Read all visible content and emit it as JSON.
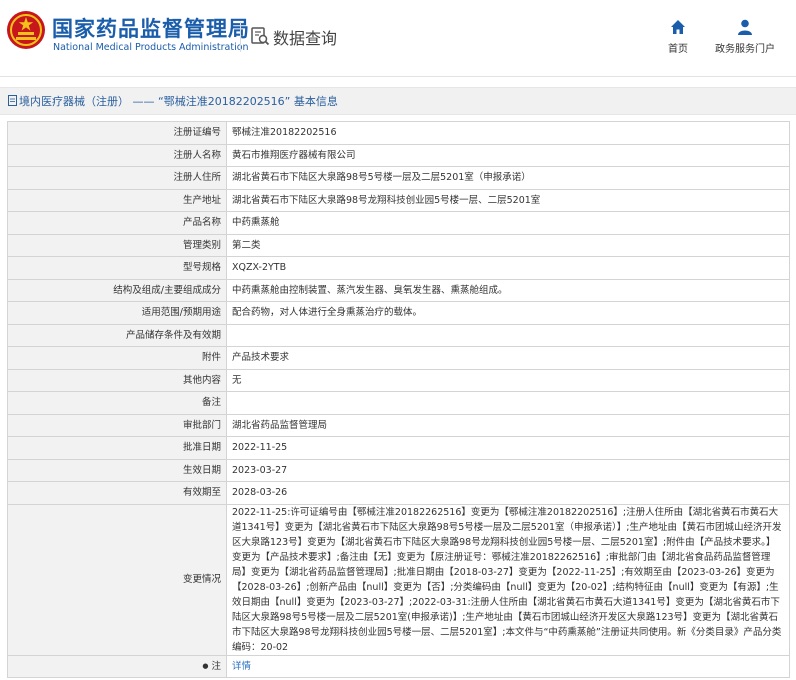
{
  "header": {
    "title_cn": "国家药品监督管理局",
    "title_en": "National Medical Products Administration",
    "query_title": "数据查询",
    "nav": [
      {
        "icon": "home-icon",
        "label": "首页"
      },
      {
        "icon": "person-icon",
        "label": "政务服务门户"
      }
    ],
    "brand_color": "#1a5dab"
  },
  "breadcrumb": {
    "section": "境内医疗器械（注册）",
    "separator": "——",
    "record": "“鄂械注准20182202516”",
    "suffix": "基本信息"
  },
  "rows": [
    {
      "label": "注册证编号",
      "value": "鄂械注准20182202516"
    },
    {
      "label": "注册人名称",
      "value": "黄石市推翔医疗器械有限公司"
    },
    {
      "label": "注册人住所",
      "value": "湖北省黄石市下陆区大泉路98号5号楼一层及二层5201室（申报承诺）"
    },
    {
      "label": "生产地址",
      "value": "湖北省黄石市下陆区大泉路98号龙翔科技创业园5号楼一层、二层5201室"
    },
    {
      "label": "产品名称",
      "value": "中药熏蒸舱"
    },
    {
      "label": "管理类别",
      "value": "第二类"
    },
    {
      "label": "型号规格",
      "value": "XQZX-2YTB"
    },
    {
      "label": "结构及组成/主要组成成分",
      "value": "中药熏蒸舱由控制装置、蒸汽发生器、臭氧发生器、熏蒸舱组成。"
    },
    {
      "label": "适用范围/预期用途",
      "value": "配合药物，对人体进行全身熏蒸治疗的载体。"
    },
    {
      "label": "产品储存条件及有效期",
      "value": ""
    },
    {
      "label": "附件",
      "value": "产品技术要求"
    },
    {
      "label": "其他内容",
      "value": "无"
    },
    {
      "label": "备注",
      "value": ""
    },
    {
      "label": "审批部门",
      "value": "湖北省药品监督管理局"
    },
    {
      "label": "批准日期",
      "value": "2022-11-25"
    },
    {
      "label": "生效日期",
      "value": "2023-03-27"
    },
    {
      "label": "有效期至",
      "value": "2028-03-26"
    }
  ],
  "change": {
    "label": "变更情况",
    "value": "2022-11-25:许可证编号由【鄂械注准20182262516】变更为【鄂械注准20182202516】;注册人住所由【湖北省黄石市黄石大道1341号】变更为【湖北省黄石市下陆区大泉路98号5号楼一层及二层5201室（申报承诺）】;生产地址由【黄石市团城山经济开发区大泉路123号】变更为【湖北省黄石市下陆区大泉路98号龙翔科技创业园5号楼一层、二层5201室】;附件由【产品技术要求。】变更为【产品技术要求】;备注由【无】变更为【原注册证号：鄂械注准20182262516】;审批部门由【湖北省食品药品监督管理局】变更为【湖北省药品监督管理局】;批准日期由【2018-03-27】变更为【2022-11-25】;有效期至由【2023-03-26】变更为【2028-03-26】;创新产品由【null】变更为【否】;分类编码由【null】变更为【20-02】;结构特征由【null】变更为【有源】;生效日期由【null】变更为【2023-03-27】;2022-03-31:注册人住所由【湖北省黄石市黄石大道1341号】变更为【湖北省黄石市下陆区大泉路98号5号楼一层及二层5201室(申报承诺)】;生产地址由【黄石市团城山经济开发区大泉路123号】变更为【湖北省黄石市下陆区大泉路98号龙翔科技创业园5号楼一层、二层5201室】;本文件与“中药熏蒸舱”注册证共同使用。新《分类目录》产品分类编码：20-02"
  },
  "note": {
    "label": "注",
    "link": "详情"
  }
}
